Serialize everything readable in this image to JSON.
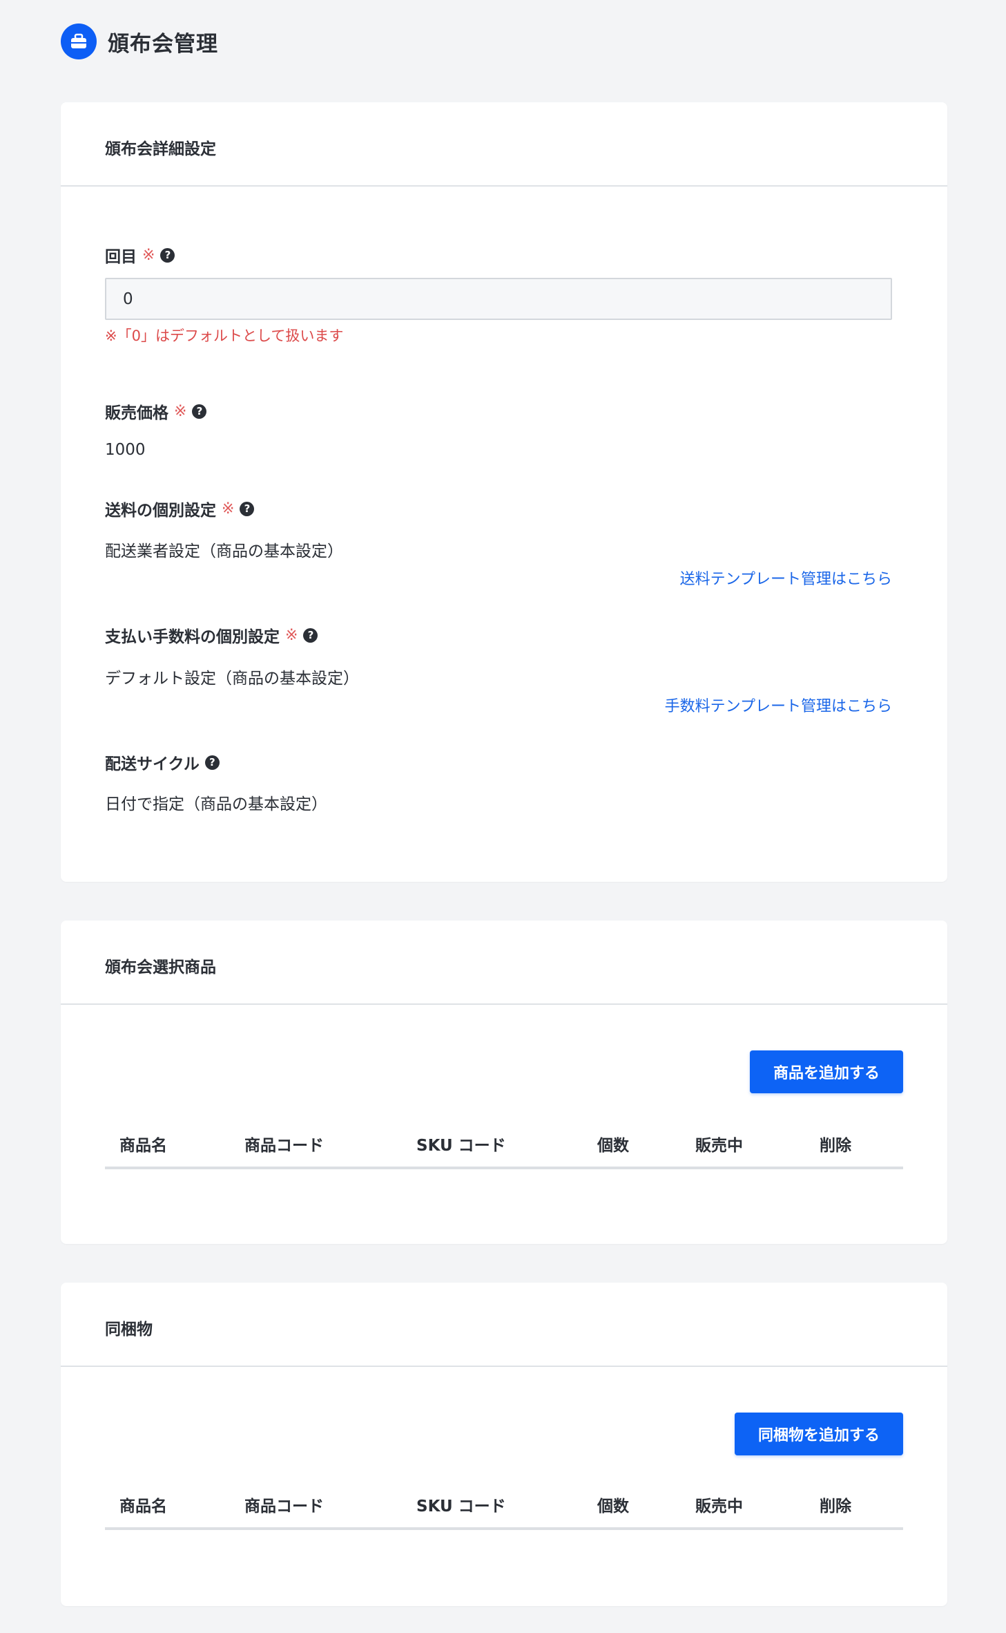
{
  "page": {
    "title": "頒布会管理",
    "icon": "briefcase-icon"
  },
  "details": {
    "title": "頒布会詳細設定",
    "round": {
      "label": "回目",
      "required": "※",
      "value": "0",
      "note": "※「0」はデフォルトとして扱います"
    },
    "price": {
      "label": "販売価格",
      "required": "※",
      "value": "1000"
    },
    "shipping": {
      "label": "送料の個別設定",
      "required": "※",
      "value": "配送業者設定（商品の基本設定）",
      "link": "送料テンプレート管理はこちら"
    },
    "fee": {
      "label": "支払い手数料の個別設定",
      "required": "※",
      "value": "デフォルト設定（商品の基本設定）",
      "link": "手数料テンプレート管理はこちら"
    },
    "cycle": {
      "label": "配送サイクル",
      "value": "日付で指定（商品の基本設定）"
    }
  },
  "products": {
    "title": "頒布会選択商品",
    "add_button": "商品を追加する",
    "columns": [
      "商品名",
      "商品コード",
      "SKU コード",
      "個数",
      "販売中",
      "削除"
    ]
  },
  "bundles": {
    "title": "同梱物",
    "add_button": "同梱物を追加する",
    "columns": [
      "商品名",
      "商品コード",
      "SKU コード",
      "個数",
      "販売中",
      "削除"
    ]
  },
  "colors": {
    "accent": "#0d63f5",
    "required": "#e05a5a",
    "link": "#1a66e8",
    "background": "#f3f4f6"
  }
}
